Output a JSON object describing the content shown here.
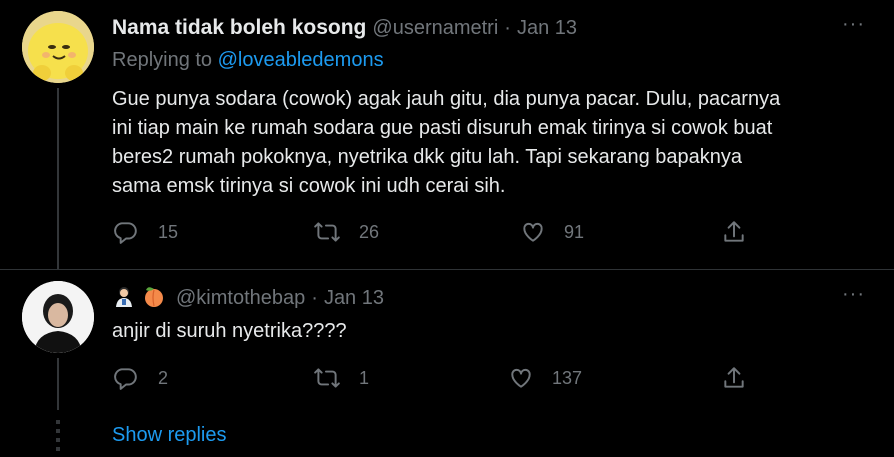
{
  "tweet1": {
    "display_name": "Nama tidak boleh kosong",
    "handle": "@usernametri",
    "separator": "·",
    "date": "Jan 13",
    "more": "···",
    "replying_prefix": "Replying to",
    "replying_handle": "@loveabledemons",
    "text_lines": [
      "Gue punya sodara (cowok) agak jauh gitu, dia punya pacar. Dulu, pacarnya",
      "ini tiap main ke rumah sodara gue pasti disuruh emak tirinya si cowok buat",
      "beres2 rumah pokoknya, nyetrika dkk gitu lah. Tapi sekarang bapaknya",
      "sama emsk tirinya si cowok ini udh cerai sih."
    ],
    "replies": "15",
    "retweets": "26",
    "likes": "91"
  },
  "tweet2": {
    "handle": "@kimtothebap",
    "separator": "·",
    "date": "Jan 13",
    "more": "···",
    "text": "anjir di suruh nyetrika????",
    "replies": "2",
    "retweets": "1",
    "likes": "137"
  },
  "show_replies": "Show replies",
  "colors": {
    "background": "#000000",
    "text": "#e7e9ea",
    "muted": "#71767b",
    "link": "#1d9bf0",
    "thread_line": "#333639"
  },
  "icons": [
    "reply-icon",
    "retweet-icon",
    "like-icon",
    "share-icon",
    "more-icon"
  ]
}
